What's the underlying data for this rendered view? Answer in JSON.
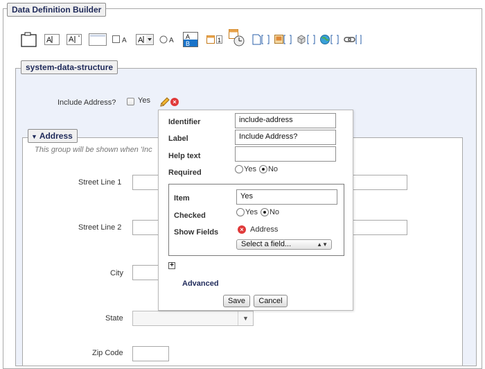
{
  "builder": {
    "title": "Data Definition Builder"
  },
  "structure": {
    "title": "system-data-structure"
  },
  "toolbar": {
    "items": [
      {
        "icon": "group-icon"
      },
      {
        "icon": "text-field-icon",
        "glyph": "A"
      },
      {
        "icon": "multiline-text-icon",
        "glyph": "A"
      },
      {
        "icon": "wysiwyg-icon"
      },
      {
        "icon": "checkbox-field-icon",
        "glyph": "A"
      },
      {
        "icon": "dropdown-field-icon",
        "glyph": "A"
      },
      {
        "icon": "radio-field-icon",
        "glyph": "A"
      },
      {
        "icon": "multiselect-field-icon",
        "glyph_top": "A",
        "glyph_bottom": "B"
      },
      {
        "icon": "calendar-field-icon",
        "glyph": "1"
      },
      {
        "icon": "datetime-field-icon"
      },
      {
        "icon": "page-chooser-icon"
      },
      {
        "icon": "file-chooser-icon"
      },
      {
        "icon": "block-chooser-icon"
      },
      {
        "icon": "symlink-chooser-icon"
      },
      {
        "icon": "link-chooser-icon"
      }
    ]
  },
  "include_address": {
    "label": "Include Address?",
    "option": "Yes"
  },
  "address_group": {
    "title": "Address",
    "hint": "This group will be shown when 'Inc",
    "fields": {
      "street1": "Street Line 1",
      "street2": "Street Line 2",
      "city": "City",
      "state": "State",
      "zip": "Zip Code"
    }
  },
  "popup": {
    "identifier_label": "Identifier",
    "identifier_value": "include-address",
    "label_label": "Label",
    "label_value": "Include Address?",
    "help_label": "Help text",
    "help_value": "",
    "required_label": "Required",
    "yes": "Yes",
    "no": "No",
    "item_label": "Item",
    "item_value": "Yes",
    "checked_label": "Checked",
    "show_fields_label": "Show Fields",
    "show_field_value": "Address",
    "select_field": "Select a field...",
    "advanced_label": "Advanced",
    "save_label": "Save",
    "cancel_label": "Cancel"
  }
}
